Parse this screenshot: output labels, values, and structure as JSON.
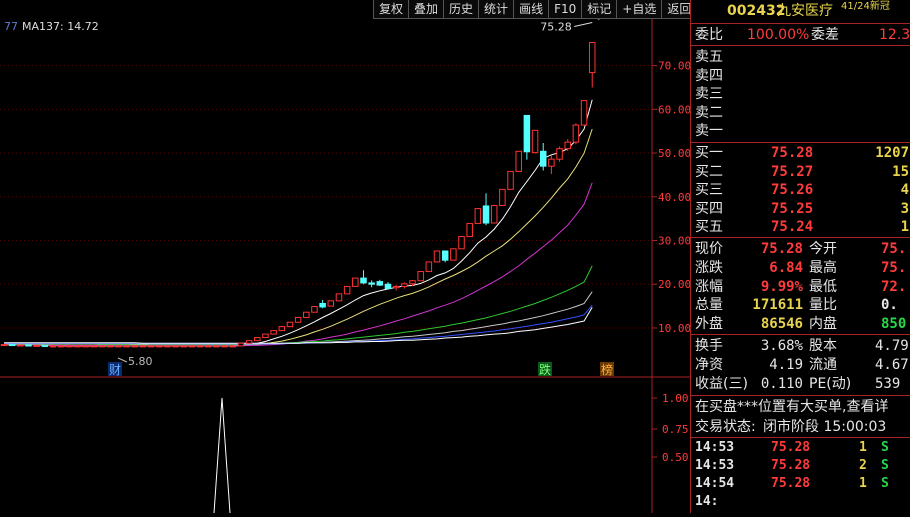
{
  "toolbar": {
    "buttons": [
      "复权",
      "叠加",
      "历史",
      "统计",
      "画线",
      "F10",
      "标记",
      "+自选",
      "返回"
    ]
  },
  "indicator": {
    "selector": "77",
    "ma_label": "MA137: 14.72"
  },
  "chart_data": {
    "type": "candlestick",
    "price_axis_ticks": [
      "70.00",
      "60.00",
      "50.00",
      "40.00",
      "30.00",
      "20.00",
      "10.00"
    ],
    "price_axis_values": [
      70,
      60,
      50,
      40,
      30,
      20,
      10
    ],
    "lower_axis_ticks": [
      "1.00",
      "0.75",
      "0.50"
    ],
    "lower_axis_values": [
      1.0,
      0.75,
      0.5
    ],
    "high_label": "75.28",
    "low_label": "5.80",
    "markers": [
      "财",
      "跌",
      "榜"
    ],
    "candles": [
      [
        6.2,
        6.3,
        6.1,
        6.2
      ],
      [
        6.2,
        6.2,
        6.0,
        6.1
      ],
      [
        6.1,
        6.2,
        6.0,
        6.1
      ],
      [
        6.1,
        6.2,
        6.0,
        6.0
      ],
      [
        6.0,
        6.1,
        5.9,
        6.0
      ],
      [
        6.0,
        6.1,
        5.8,
        5.9
      ],
      [
        5.9,
        6.0,
        5.8,
        5.9
      ],
      [
        5.9,
        6.0,
        5.8,
        5.9
      ],
      [
        5.9,
        6.0,
        5.8,
        5.9
      ],
      [
        5.9,
        6.0,
        5.8,
        5.9
      ],
      [
        5.9,
        6.0,
        5.8,
        5.9
      ],
      [
        5.9,
        6.0,
        5.8,
        5.9
      ],
      [
        5.9,
        6.0,
        5.8,
        5.9
      ],
      [
        5.9,
        6.0,
        5.8,
        5.9
      ],
      [
        5.9,
        6.0,
        5.8,
        5.9
      ],
      [
        5.9,
        6.0,
        5.8,
        5.9
      ],
      [
        5.9,
        6.0,
        5.8,
        5.9
      ],
      [
        5.9,
        6.0,
        5.8,
        5.9
      ],
      [
        5.9,
        6.0,
        5.8,
        5.9
      ],
      [
        5.9,
        6.0,
        5.8,
        5.9
      ],
      [
        5.9,
        6.0,
        5.8,
        5.9
      ],
      [
        5.9,
        6.0,
        5.8,
        5.9
      ],
      [
        5.9,
        6.0,
        5.8,
        5.9
      ],
      [
        5.9,
        6.0,
        5.8,
        5.9
      ],
      [
        5.9,
        6.0,
        5.8,
        5.9
      ],
      [
        5.9,
        6.0,
        5.8,
        5.9
      ],
      [
        5.9,
        6.0,
        5.8,
        5.9
      ],
      [
        5.9,
        6.0,
        5.8,
        5.9
      ],
      [
        5.9,
        6.0,
        5.8,
        5.9
      ],
      [
        5.9,
        6.6,
        5.9,
        6.5
      ],
      [
        6.5,
        7.2,
        6.5,
        7.1
      ],
      [
        7.1,
        7.9,
        7.1,
        7.8
      ],
      [
        7.8,
        8.6,
        7.8,
        8.6
      ],
      [
        8.6,
        9.5,
        8.6,
        9.4
      ],
      [
        9.4,
        10.4,
        9.4,
        10.3
      ],
      [
        10.3,
        11.4,
        10.3,
        11.3
      ],
      [
        11.3,
        12.4,
        11.3,
        12.4
      ],
      [
        12.4,
        13.6,
        12.4,
        13.6
      ],
      [
        13.6,
        15.0,
        13.6,
        14.9
      ],
      [
        15.6,
        16.4,
        14.5,
        14.8
      ],
      [
        15.0,
        16.3,
        14.9,
        16.2
      ],
      [
        16.2,
        17.8,
        16.2,
        17.8
      ],
      [
        17.8,
        19.6,
        17.8,
        19.5
      ],
      [
        19.5,
        21.5,
        19.5,
        21.4
      ],
      [
        21.4,
        23.2,
        20.0,
        20.3
      ],
      [
        20.3,
        20.9,
        19.3,
        20.0
      ],
      [
        20.6,
        21.0,
        19.6,
        19.8
      ],
      [
        20.0,
        20.5,
        18.9,
        19.0
      ],
      [
        19.2,
        19.8,
        18.6,
        19.5
      ],
      [
        19.5,
        20.4,
        19.0,
        20.1
      ],
      [
        20.1,
        21.0,
        19.6,
        20.8
      ],
      [
        20.8,
        22.9,
        20.8,
        22.9
      ],
      [
        22.9,
        25.1,
        22.9,
        25.1
      ],
      [
        25.1,
        27.6,
        25.1,
        27.6
      ],
      [
        27.6,
        26.8,
        25.0,
        25.5
      ],
      [
        25.5,
        28.2,
        25.5,
        28.1
      ],
      [
        28.1,
        31.0,
        28.1,
        30.9
      ],
      [
        30.9,
        34.0,
        30.9,
        33.9
      ],
      [
        33.9,
        37.3,
        33.9,
        37.3
      ],
      [
        37.9,
        40.8,
        33.5,
        34.0
      ],
      [
        34.0,
        38.2,
        33.9,
        38.0
      ],
      [
        38.0,
        41.7,
        38.0,
        41.7
      ],
      [
        41.7,
        45.9,
        41.7,
        45.8
      ],
      [
        45.8,
        50.4,
        45.8,
        50.4
      ],
      [
        58.6,
        58.6,
        48.5,
        50.3
      ],
      [
        50.1,
        55.3,
        49.9,
        55.2
      ],
      [
        50.4,
        52.3,
        46.0,
        47.0
      ],
      [
        47.0,
        49.5,
        45.2,
        48.6
      ],
      [
        48.6,
        51.5,
        48.0,
        51.0
      ],
      [
        51.0,
        53.2,
        50.5,
        52.5
      ],
      [
        52.5,
        56.8,
        52.0,
        56.4
      ],
      [
        56.4,
        62.0,
        56.4,
        62.0
      ],
      [
        68.4,
        75.28,
        65.0,
        75.28
      ]
    ],
    "ma_series": [
      {
        "color": "#ffffff",
        "values": [
          6.2,
          6.2,
          6.1,
          6.1,
          6.1,
          6.0,
          6.0,
          5.9,
          5.9,
          5.9,
          5.9,
          5.9,
          5.9,
          5.9,
          5.9,
          5.9,
          5.9,
          5.9,
          5.9,
          5.9,
          5.9,
          5.9,
          5.9,
          5.9,
          5.9,
          5.9,
          5.9,
          5.9,
          5.9,
          6.0,
          6.2,
          6.5,
          6.9,
          7.5,
          8.1,
          8.8,
          9.6,
          10.5,
          11.4,
          12.4,
          13.3,
          14.3,
          15.3,
          16.4,
          17.4,
          18.0,
          18.5,
          18.9,
          19.3,
          19.6,
          19.7,
          20.2,
          21.0,
          22.0,
          22.6,
          23.6,
          25.3,
          27.2,
          29.4,
          30.8,
          32.6,
          34.9,
          37.7,
          41.0,
          43.5,
          46.0,
          48.8,
          49.6,
          50.1,
          51.0,
          52.9,
          55.5,
          62.2
        ]
      },
      {
        "color": "#e8e07a",
        "values": [
          6.2,
          6.2,
          6.1,
          6.1,
          6.1,
          6.0,
          6.0,
          6.0,
          6.0,
          5.9,
          5.9,
          5.9,
          5.9,
          5.9,
          5.9,
          5.9,
          5.9,
          5.9,
          5.9,
          5.9,
          5.9,
          5.9,
          5.9,
          5.9,
          5.9,
          5.9,
          5.9,
          5.9,
          5.9,
          6.0,
          6.0,
          6.2,
          6.4,
          6.7,
          7.0,
          7.4,
          7.9,
          8.4,
          9.1,
          9.7,
          10.4,
          11.2,
          12.0,
          12.9,
          13.8,
          14.6,
          15.4,
          16.1,
          16.8,
          17.4,
          17.9,
          18.6,
          19.4,
          20.3,
          21.2,
          22.0,
          22.9,
          23.9,
          25.1,
          26.4,
          27.6,
          28.8,
          30.3,
          32.0,
          33.8,
          35.6,
          37.6,
          39.7,
          42.0,
          44.1,
          46.8,
          50.0,
          55.5
        ]
      },
      {
        "color": "#d034d0",
        "values": [
          6.2,
          6.2,
          6.1,
          6.1,
          6.1,
          6.0,
          6.0,
          6.0,
          6.0,
          6.0,
          6.0,
          6.0,
          6.0,
          6.0,
          5.9,
          5.9,
          5.9,
          5.9,
          5.9,
          5.9,
          5.9,
          5.9,
          5.9,
          5.9,
          5.9,
          5.9,
          5.9,
          5.9,
          5.9,
          5.9,
          6.0,
          6.0,
          6.1,
          6.2,
          6.3,
          6.5,
          6.7,
          7.0,
          7.2,
          7.5,
          7.9,
          8.2,
          8.6,
          9.1,
          9.5,
          10.0,
          10.5,
          11.0,
          11.6,
          12.1,
          12.7,
          13.3,
          13.9,
          14.6,
          15.2,
          15.9,
          16.7,
          17.6,
          18.6,
          19.6,
          20.6,
          21.7,
          22.9,
          24.2,
          25.7,
          27.1,
          28.6,
          30.1,
          31.8,
          33.5,
          35.8,
          38.3,
          43.2
        ]
      },
      {
        "color": "#2fc82f",
        "values": [
          6.3,
          6.3,
          6.3,
          6.3,
          6.3,
          6.3,
          6.3,
          6.3,
          6.3,
          6.3,
          6.3,
          6.3,
          6.2,
          6.2,
          6.2,
          6.2,
          6.2,
          6.2,
          6.2,
          6.2,
          6.2,
          6.2,
          6.2,
          6.2,
          6.2,
          6.2,
          6.2,
          6.2,
          6.2,
          6.2,
          6.3,
          6.3,
          6.4,
          6.4,
          6.5,
          6.6,
          6.7,
          6.8,
          6.9,
          7.0,
          7.2,
          7.3,
          7.5,
          7.7,
          7.9,
          8.1,
          8.3,
          8.5,
          8.7,
          9.0,
          9.2,
          9.5,
          9.8,
          10.1,
          10.4,
          10.8,
          11.1,
          11.5,
          11.9,
          12.3,
          12.8,
          13.3,
          13.8,
          14.4,
          15.0,
          15.6,
          16.3,
          17.0,
          17.8,
          18.6,
          19.5,
          20.5,
          24.2
        ]
      },
      {
        "color": "#c8c8c8",
        "values": [
          6.4,
          6.4,
          6.4,
          6.4,
          6.4,
          6.4,
          6.4,
          6.4,
          6.4,
          6.4,
          6.4,
          6.4,
          6.4,
          6.4,
          6.4,
          6.4,
          6.3,
          6.3,
          6.3,
          6.3,
          6.3,
          6.3,
          6.3,
          6.3,
          6.3,
          6.3,
          6.3,
          6.3,
          6.3,
          6.3,
          6.3,
          6.3,
          6.4,
          6.4,
          6.4,
          6.5,
          6.5,
          6.6,
          6.6,
          6.7,
          6.8,
          6.9,
          7.0,
          7.1,
          7.2,
          7.3,
          7.5,
          7.6,
          7.8,
          8.0,
          8.1,
          8.3,
          8.5,
          8.7,
          8.9,
          9.2,
          9.4,
          9.7,
          10.0,
          10.3,
          10.6,
          10.9,
          11.3,
          11.6,
          12.0,
          12.4,
          12.8,
          13.3,
          13.8,
          14.3,
          14.9,
          15.6,
          18.3
        ]
      },
      {
        "color": "#3050ff",
        "values": [
          6.5,
          6.5,
          6.5,
          6.5,
          6.5,
          6.5,
          6.5,
          6.5,
          6.5,
          6.5,
          6.5,
          6.5,
          6.5,
          6.5,
          6.5,
          6.5,
          6.5,
          6.5,
          6.4,
          6.4,
          6.4,
          6.4,
          6.4,
          6.4,
          6.4,
          6.4,
          6.4,
          6.4,
          6.4,
          6.4,
          6.4,
          6.4,
          6.4,
          6.4,
          6.4,
          6.5,
          6.5,
          6.5,
          6.6,
          6.6,
          6.7,
          6.7,
          6.8,
          6.9,
          6.9,
          7.0,
          7.1,
          7.2,
          7.3,
          7.4,
          7.5,
          7.7,
          7.8,
          8.0,
          8.1,
          8.3,
          8.5,
          8.7,
          8.9,
          9.1,
          9.3,
          9.6,
          9.8,
          10.1,
          10.4,
          10.7,
          11.0,
          11.3,
          11.7,
          12.1,
          12.5,
          13.0,
          15.2
        ]
      },
      {
        "color": "#ffffff",
        "values": [
          6.6,
          6.6,
          6.6,
          6.6,
          6.6,
          6.6,
          6.6,
          6.6,
          6.6,
          6.6,
          6.6,
          6.6,
          6.6,
          6.6,
          6.6,
          6.6,
          6.6,
          6.5,
          6.5,
          6.5,
          6.5,
          6.5,
          6.5,
          6.5,
          6.5,
          6.5,
          6.5,
          6.5,
          6.5,
          6.5,
          6.5,
          6.5,
          6.5,
          6.5,
          6.5,
          6.5,
          6.5,
          6.6,
          6.6,
          6.6,
          6.6,
          6.7,
          6.7,
          6.8,
          6.8,
          6.9,
          6.9,
          7.0,
          7.1,
          7.2,
          7.2,
          7.3,
          7.4,
          7.5,
          7.7,
          7.8,
          7.9,
          8.1,
          8.2,
          8.4,
          8.6,
          8.7,
          8.9,
          9.2,
          9.4,
          9.6,
          9.9,
          10.2,
          10.5,
          10.8,
          11.2,
          11.6,
          14.72
        ]
      }
    ]
  },
  "quote": {
    "code": "002432",
    "name": "九安医疗",
    "tag": "41/24新冠",
    "weibi_label": "委比",
    "weibi_value": "100.00%",
    "weicha_label": "委差",
    "weicha_value": "12.3",
    "sell": [
      {
        "label": "卖五"
      },
      {
        "label": "卖四"
      },
      {
        "label": "卖三"
      },
      {
        "label": "卖二"
      },
      {
        "label": "卖一"
      }
    ],
    "buy": [
      {
        "label": "买一",
        "price": "75.28",
        "vol": "1207"
      },
      {
        "label": "买二",
        "price": "75.27",
        "vol": "15"
      },
      {
        "label": "买三",
        "price": "75.26",
        "vol": "4"
      },
      {
        "label": "买四",
        "price": "75.25",
        "vol": "3"
      },
      {
        "label": "买五",
        "price": "75.24",
        "vol": "1"
      }
    ],
    "stats1": [
      {
        "l1": "现价",
        "v1": "75.28",
        "l2": "今开",
        "v2": "75."
      },
      {
        "l1": "涨跌",
        "v1": "6.84",
        "l2": "最高",
        "v2": "75."
      },
      {
        "l1": "涨幅",
        "v1": "9.99%",
        "l2": "最低",
        "v2": "72."
      },
      {
        "l1": "总量",
        "v1": "171611",
        "l2": "量比",
        "v2": "0."
      },
      {
        "l1": "外盘",
        "v1": "86546",
        "l2": "内盘",
        "v2": "850"
      }
    ],
    "stats2": [
      {
        "l1": "换手",
        "v1": "3.68%",
        "l2": "股本",
        "v2": "4.79"
      },
      {
        "l1": "净资",
        "v1": "4.19",
        "l2": "流通",
        "v2": "4.67"
      },
      {
        "l1": "收益(三)",
        "v1": "0.110",
        "l2": "PE(动)",
        "v2": "539"
      }
    ],
    "notice": "在买盘***位置有大买单,查看详",
    "status_label": "交易状态:",
    "status_value": "闭市阶段 15:00:03",
    "ticks": [
      {
        "time": "14:53",
        "price": "75.28",
        "vol": "1",
        "side": "S"
      },
      {
        "time": "14:53",
        "price": "75.28",
        "vol": "2",
        "side": "S"
      },
      {
        "time": "14:54",
        "price": "75.28",
        "vol": "1",
        "side": "S"
      },
      {
        "time": "14:",
        "price": "",
        "vol": "",
        "side": ""
      }
    ]
  },
  "colors": {
    "up": "#ff3333",
    "down": "#54ffff",
    "axis": "#aa2222",
    "grid": "#550000"
  }
}
